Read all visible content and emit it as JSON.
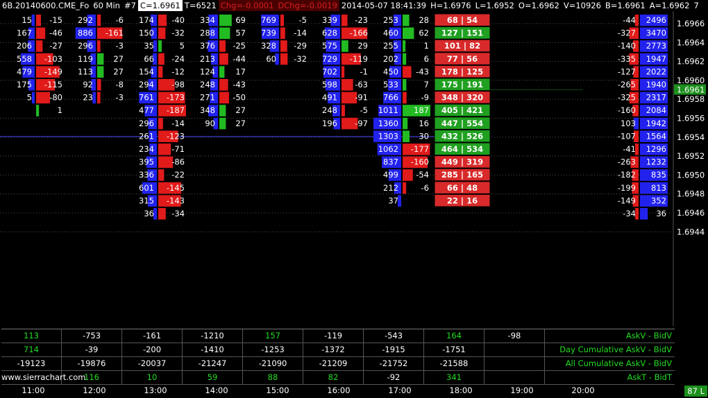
{
  "header": {
    "symbol": "6B.20140600.CME_Fo",
    "period": "60 Min",
    "bar_num": "#7",
    "close": "C=1.6961",
    "trades": "T=6521",
    "chg": "Chg=-0.0001",
    "dchg": "DChg=-0.0019",
    "datetime": "2014-05-07  18:41:39",
    "high": "H=1.6976",
    "low": "L=1.6952",
    "open": "O=1.6962",
    "volume": "V=10926",
    "bid": "B=1.6961",
    "ask": "A=1.6962",
    "last": "7"
  },
  "price_axis": [
    "1.6966",
    "1.6964",
    "1.6962",
    "1.6960",
    "1.6958",
    "1.6956",
    "1.6954",
    "1.6952",
    "1.6950",
    "1.6948",
    "1.6946",
    "1.6944"
  ],
  "current_price": "1.6961",
  "colors": {
    "ask": "#2222ee",
    "bid": "#e11a1a",
    "up": "#22bb22",
    "down": "#d02020",
    "pos": "#22dd22",
    "neg": "#ff8080"
  },
  "bars": [
    {
      "l": [
        15,
        167,
        206,
        558,
        479,
        175,
        5
      ],
      "r": [
        -15,
        -46,
        -27,
        -103,
        -149,
        -115,
        -80,
        1
      ],
      "bx": [
        null,
        null,
        893,
        null,
        null,
        null,
        null
      ],
      "rx": [
        null,
        null,
        null,
        -149,
        null,
        null,
        null
      ]
    },
    {
      "l": [
        292,
        886,
        296,
        119,
        113,
        92,
        23
      ],
      "r": [
        -6,
        -161,
        -3,
        27,
        27,
        -8,
        -3
      ]
    },
    {
      "l": [
        174,
        150,
        35,
        66,
        154,
        294,
        761,
        477,
        296,
        261,
        234,
        395,
        336,
        601,
        315,
        36
      ],
      "r": [
        -40,
        -32,
        5,
        -24,
        -12,
        -98,
        -173,
        -187,
        -14,
        -123,
        -71,
        -86,
        -22,
        -145,
        -143,
        -34
      ]
    },
    {
      "l": [
        334,
        288,
        376,
        213,
        124,
        248,
        271,
        348,
        90
      ],
      "r": [
        69,
        57,
        -25,
        -44,
        17,
        -43,
        -50,
        27,
        27
      ]
    },
    {
      "l": [
        769,
        739,
        328,
        60
      ],
      "r": [
        -5,
        -14,
        -29,
        -32
      ]
    },
    {
      "l": [
        339,
        628,
        575,
        729,
        702,
        598,
        491,
        248,
        196
      ],
      "r": [
        -23,
        -166,
        29,
        -119,
        -1,
        -63,
        -91,
        -5,
        -97
      ]
    },
    {
      "l": [
        253,
        460,
        255,
        202,
        450,
        533,
        766,
        1011,
        1360,
        1303,
        1062,
        837,
        499,
        212,
        37
      ],
      "r": [
        28,
        62,
        1,
        6,
        -43,
        7,
        -9,
        187,
        16,
        30,
        -177,
        -160,
        -54,
        -6
      ]
    },
    {
      "l": [
        68,
        127,
        101,
        77,
        178,
        175,
        348,
        405,
        447,
        432,
        464,
        449,
        285,
        66,
        22
      ],
      "r": [
        54,
        151,
        82,
        56,
        125,
        191,
        320,
        421,
        554,
        526,
        534,
        319,
        165,
        48,
        16
      ]
    },
    {
      "l": [
        -44,
        -327,
        -140,
        -335,
        -127,
        -265,
        -325,
        -160,
        103,
        -107,
        -41,
        -263,
        -182,
        -199,
        -149,
        -34
      ],
      "r": [
        2496,
        3470,
        2773,
        1947,
        2022,
        1940,
        2317,
        2084,
        1942,
        1564,
        1296,
        1232,
        835,
        813,
        352,
        36
      ]
    }
  ],
  "table": {
    "rows": [
      {
        "label": "AskV - BidV",
        "values": [
          "113",
          "-753",
          "-161",
          "-1210",
          "157",
          "-119",
          "-543",
          "164",
          "-98"
        ]
      },
      {
        "label": "Day Cumulative AskV - BidV",
        "values": [
          "714",
          "-39",
          "-200",
          "-1410",
          "-1253",
          "-1372",
          "-1915",
          "-1751",
          ""
        ]
      },
      {
        "label": "All Cumulative AskV - BidV",
        "values": [
          "-19123",
          "-19876",
          "-20037",
          "-21247",
          "-21090",
          "-21209",
          "-21752",
          "-21588",
          ""
        ]
      },
      {
        "label": "AskT - BidT",
        "values": [
          "",
          "116",
          "10",
          "59",
          "88",
          "82",
          "-92",
          "341",
          ""
        ]
      }
    ]
  },
  "watermark": "www.sierrachart.com",
  "time_axis": [
    "11:00",
    "12:00",
    "13:00",
    "14:00",
    "15:00",
    "16:00",
    "17:00",
    "18:00",
    "19:00",
    "20:00"
  ],
  "badge": "87 L"
}
